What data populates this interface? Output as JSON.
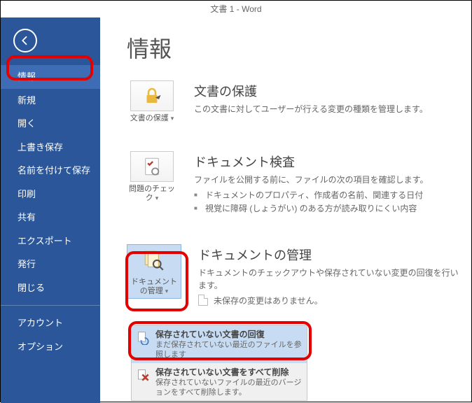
{
  "window": {
    "title": "文書 1 - Word"
  },
  "sidebar": {
    "items": [
      {
        "label": "情報",
        "selected": true
      },
      {
        "label": "新規"
      },
      {
        "label": "開く"
      },
      {
        "label": "上書き保存"
      },
      {
        "label": "名前を付けて保存"
      },
      {
        "label": "印刷"
      },
      {
        "label": "共有"
      },
      {
        "label": "エクスポート"
      },
      {
        "label": "発行"
      },
      {
        "label": "閉じる"
      }
    ],
    "footer_items": [
      {
        "label": "アカウント"
      },
      {
        "label": "オプション"
      }
    ]
  },
  "page": {
    "heading": "情報",
    "protect": {
      "tile_label": "文書の保護",
      "heading": "文書の保護",
      "desc": "この文書に対してユーザーが行える変更の種類を管理します。"
    },
    "inspect": {
      "tile_label": "問題のチェック",
      "heading": "ドキュメント検査",
      "desc": "ファイルを公開する前に、ファイルの次の項目を確認します。",
      "bullets": [
        "ドキュメントのプロパティ、作成者の名前、関連する日付",
        "視覚に障碍 (しょうがい) のある方が読み取りにくい内容"
      ]
    },
    "manage": {
      "tile_label": "ドキュメントの管理",
      "heading": "ドキュメントの管理",
      "desc": "ドキュメントのチェックアウトや保存されていない変更の回復を行います。",
      "unsaved": "未保存の変更はありません。"
    },
    "menu": {
      "recover": {
        "title": "保存されていない文書の回復",
        "desc": "まだ保存されていない最近のファイルを参照します"
      },
      "delete": {
        "title": "保存されていない文書をすべて削除",
        "desc": "保存されていないファイルの最近のバージョンをすべて削除します。"
      }
    }
  }
}
